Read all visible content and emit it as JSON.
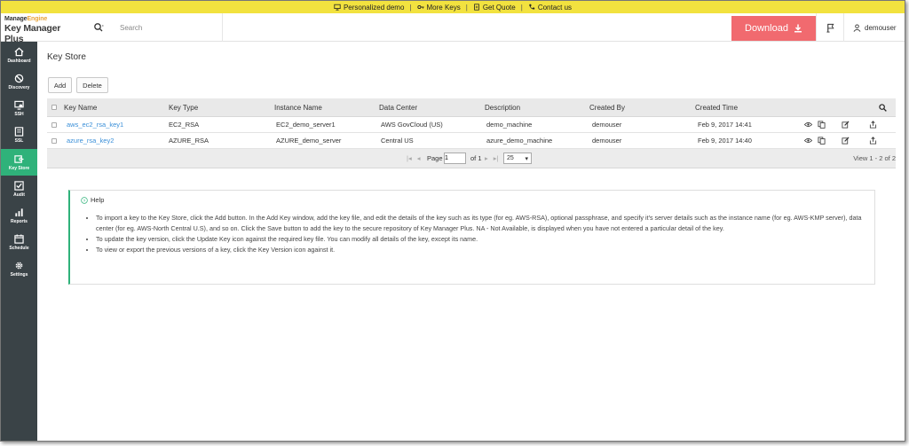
{
  "promo": {
    "personalized": "Personalized demo",
    "more_keys": "More Keys",
    "get_quote": "Get Quote",
    "contact": "Contact us"
  },
  "header": {
    "brand_line1_a": "Manage",
    "brand_line1_b": "Engine",
    "brand_line2": "Key Manager Plus",
    "search_placeholder": "Search",
    "download_label": "Download",
    "username": "demouser"
  },
  "sidebar": {
    "items": [
      {
        "label": "Dashboard",
        "icon": "home-icon"
      },
      {
        "label": "Discovery",
        "icon": "discovery-icon"
      },
      {
        "label": "SSH",
        "icon": "ssh-icon"
      },
      {
        "label": "SSL",
        "icon": "ssl-icon"
      },
      {
        "label": "Key Store",
        "icon": "key-store-icon",
        "active": true
      },
      {
        "label": "Audit",
        "icon": "audit-icon"
      },
      {
        "label": "Reports",
        "icon": "reports-icon"
      },
      {
        "label": "Schedule",
        "icon": "schedule-icon"
      },
      {
        "label": "Settings",
        "icon": "gear-icon"
      }
    ]
  },
  "page": {
    "title": "Key Store",
    "add_label": "Add",
    "delete_label": "Delete"
  },
  "table": {
    "columns": [
      "Key Name",
      "Key Type",
      "Instance Name",
      "Data Center",
      "Description",
      "Created By",
      "Created Time"
    ],
    "rows": [
      {
        "key_name": "aws_ec2_rsa_key1",
        "key_type": "EC2_RSA",
        "instance": "EC2_demo_server1",
        "data_center": "AWS GovCloud (US)",
        "description": "demo_machine",
        "created_by": "demouser",
        "created_time": "Feb 9, 2017 14:41"
      },
      {
        "key_name": "azure_rsa_key2",
        "key_type": "AZURE_RSA",
        "instance": "AZURE_demo_server",
        "data_center": "Central US",
        "description": "azure_demo_machine",
        "created_by": "demouser",
        "created_time": "Feb 9, 2017 14:40"
      }
    ],
    "pager": {
      "page_label": "Page",
      "page_value": "1",
      "of_label": "of 1",
      "page_size": "25",
      "view_text": "View 1 - 2 of 2"
    }
  },
  "help": {
    "title": "Help",
    "items": [
      "To import a key to the Key Store, click the Add button. In the Add Key window, add the key file, and edit the details of the key such as its type (for eg. AWS-RSA), optional passphrase, and specify it's server details such as the instance name (for eg. AWS-KMP server), data center (for eg. AWS-North Central U.S), and so on. Click the Save button to add the key to the secure repository of Key Manager Plus. NA - Not Available, is displayed when you have not entered a particular detail of the key.",
      "To update the key version, click the Update Key icon against the required key file. You can modify all details of the key, except its name.",
      "To view or export the previous versions of a key, click the Key Version icon against it."
    ]
  },
  "colors": {
    "promo_bar": "#f2e23f",
    "download": "#f16a6f",
    "sidebar": "#3a4347",
    "active_nav": "#2fb27a",
    "link": "#3a8fd8"
  }
}
